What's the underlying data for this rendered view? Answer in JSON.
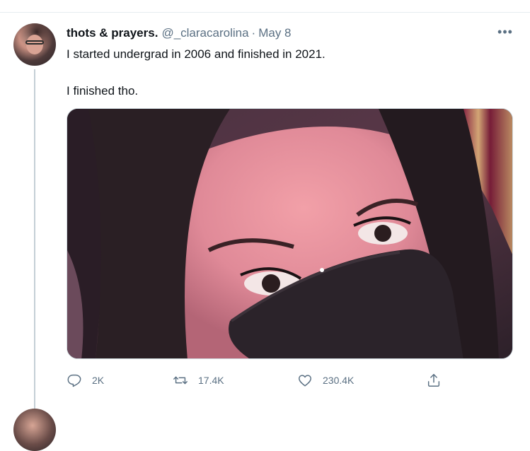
{
  "tweet": {
    "display_name": "thots & prayers.",
    "handle": "@_claracarolina",
    "separator": "·",
    "date": "May 8",
    "text_line1": "I started undergrad in 2006 and finished in 2021.",
    "text_line2": "I finished tho.",
    "more_label": "•••"
  },
  "actions": {
    "reply_count": "2K",
    "retweet_count": "17.4K",
    "like_count": "230.4K"
  },
  "icons": {
    "reply": "reply-icon",
    "retweet": "retweet-icon",
    "like": "heart-icon",
    "share": "share-icon",
    "more": "more-icon"
  },
  "colors": {
    "secondary_text": "#5b7083",
    "primary_text": "#0f1419",
    "thread_line": "#c4cfd6"
  }
}
